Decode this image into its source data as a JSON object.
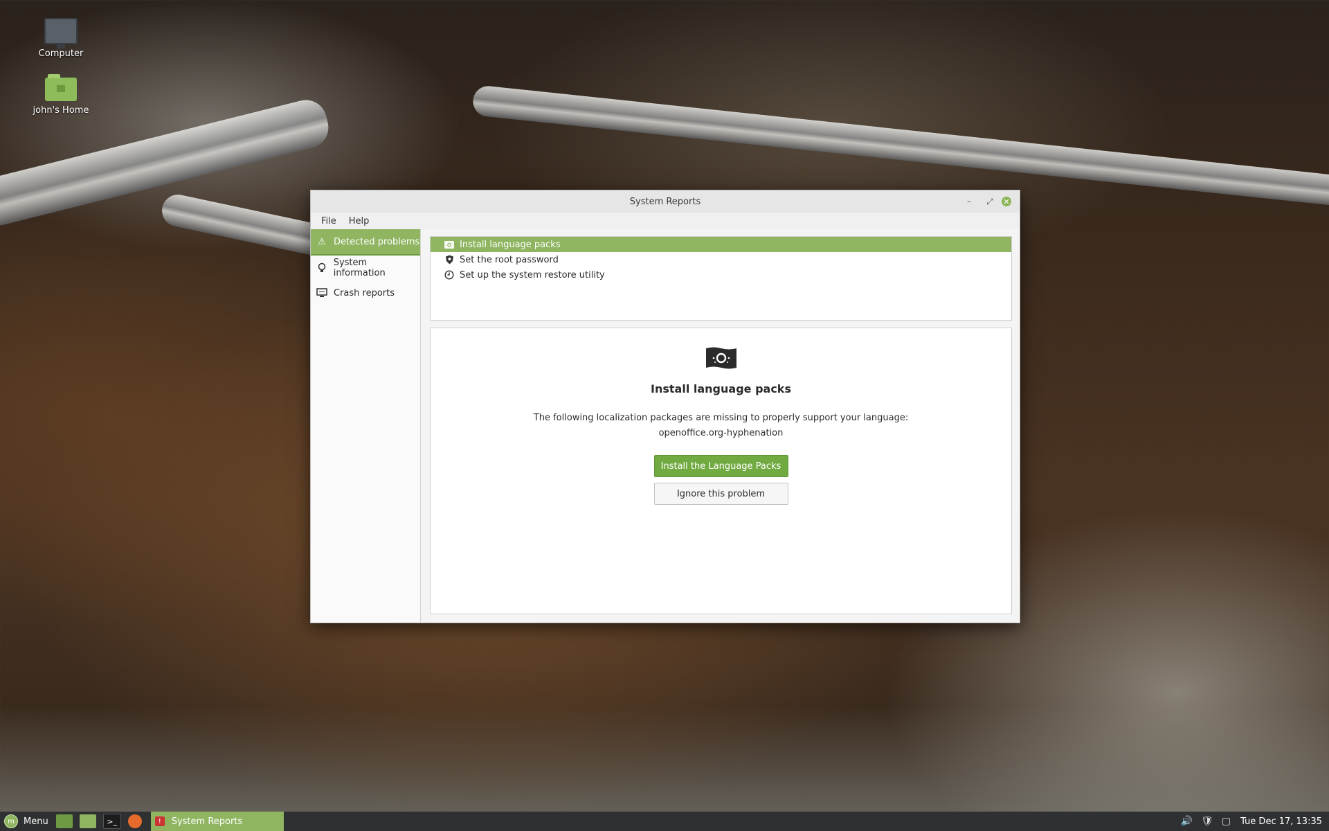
{
  "desktop": {
    "icons": [
      {
        "label": "Computer",
        "icon": "computer-icon"
      },
      {
        "label": "john's Home",
        "icon": "home-folder-icon"
      }
    ]
  },
  "window": {
    "title": "System Reports",
    "menu": [
      "File",
      "Help"
    ],
    "sidebar": [
      {
        "label": "Detected problems",
        "icon": "warning-icon",
        "active": true
      },
      {
        "label": "System information",
        "icon": "lightbulb-icon",
        "active": false
      },
      {
        "label": "Crash reports",
        "icon": "monitor-icon",
        "active": false
      }
    ],
    "problems": [
      {
        "label": "Install language packs",
        "icon": "language-flag-icon",
        "active": true
      },
      {
        "label": "Set the root password",
        "icon": "shield-icon",
        "active": false
      },
      {
        "label": "Set up the system restore utility",
        "icon": "restore-clock-icon",
        "active": false
      }
    ],
    "detail": {
      "title": "Install language packs",
      "description_line1": "The following localization packages are missing to properly support your language:",
      "description_line2": "openoffice.org-hyphenation",
      "primary_button": "Install the Language Packs",
      "secondary_button": "Ignore this problem"
    }
  },
  "taskbar": {
    "menu_label": "Menu",
    "task_label": "System Reports",
    "clock": "Tue Dec 17, 13:35"
  },
  "colors": {
    "accent": "#8fb561",
    "button_primary": "#71aa41",
    "taskbar": "#2f3032"
  }
}
